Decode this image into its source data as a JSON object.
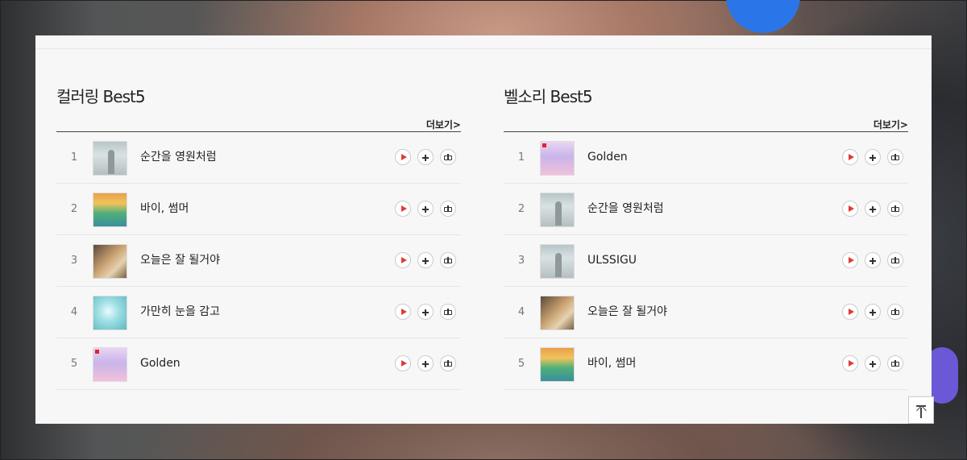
{
  "left_section": {
    "title": "컬러링 Best5",
    "more_label": "더보기>",
    "items": [
      {
        "rank": "1",
        "title": "순간을 영원처럼",
        "art": "thumb-a"
      },
      {
        "rank": "2",
        "title": "바이, 썸머",
        "art": "thumb-b"
      },
      {
        "rank": "3",
        "title": "오늘은 잘 될거야",
        "art": "thumb-c"
      },
      {
        "rank": "4",
        "title": "가만히 눈을 감고",
        "art": "thumb-d"
      },
      {
        "rank": "5",
        "title": "Golden",
        "art": "thumb-e"
      }
    ]
  },
  "right_section": {
    "title": "벨소리 Best5",
    "more_label": "더보기>",
    "items": [
      {
        "rank": "1",
        "title": "Golden",
        "art": "thumb-e"
      },
      {
        "rank": "2",
        "title": "순간을 영원처럼",
        "art": "thumb-a"
      },
      {
        "rank": "3",
        "title": "ULSSIGU",
        "art": "thumb-a"
      },
      {
        "rank": "4",
        "title": "오늘은 잘 될거야",
        "art": "thumb-c"
      },
      {
        "rank": "5",
        "title": "바이, 썸머",
        "art": "thumb-b"
      }
    ]
  },
  "row_actions": [
    "play-icon",
    "add-icon",
    "gift-icon"
  ],
  "colors": {
    "panel_bg": "#f7f7f7",
    "play_accent": "#e23a3a",
    "header_rule": "#444444"
  }
}
